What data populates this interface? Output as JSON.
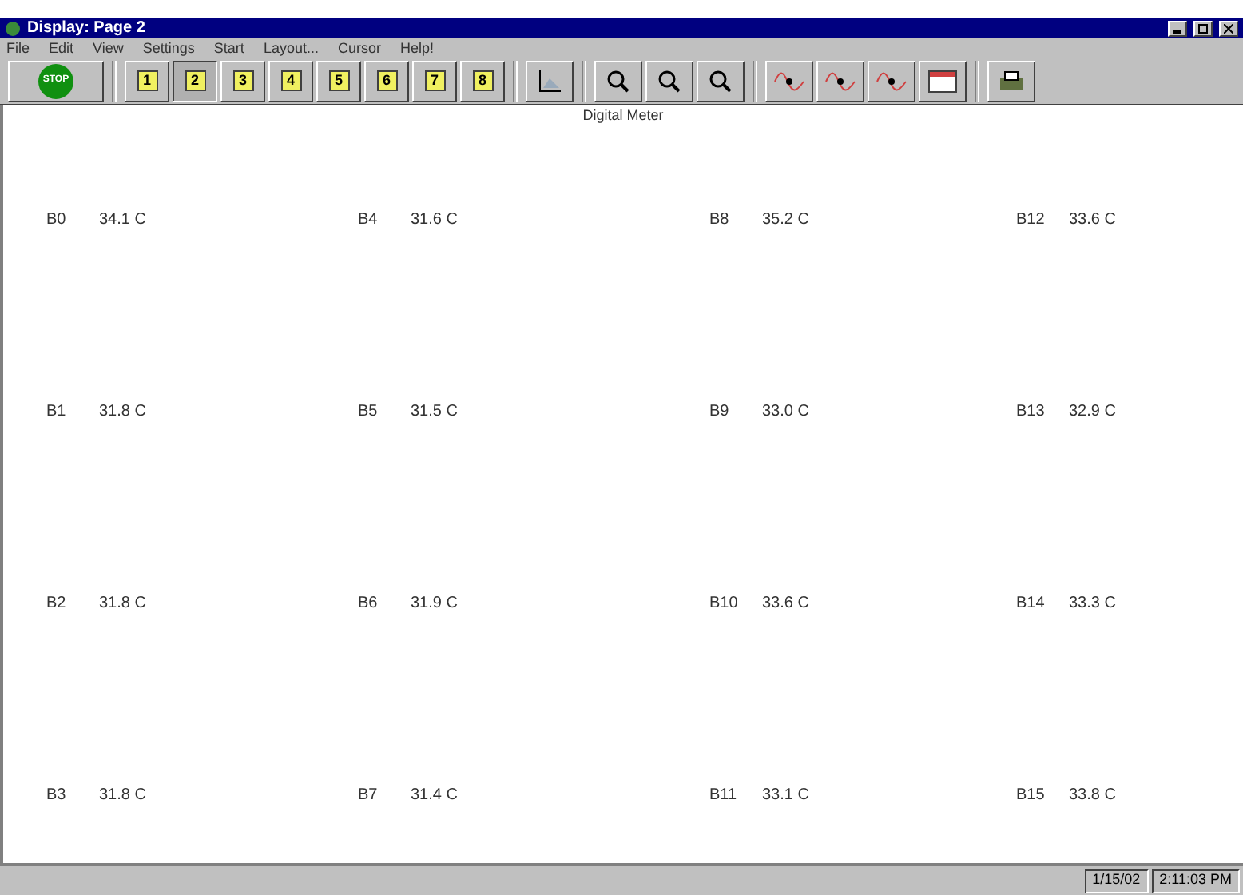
{
  "window": {
    "title": "Display: Page 2"
  },
  "menu": [
    "File",
    "Edit",
    "View",
    "Settings",
    "Start",
    "Layout...",
    "Cursor",
    "Help!"
  ],
  "toolbar": {
    "stop_label": "STOP",
    "pages": [
      {
        "label": "1",
        "selected": false
      },
      {
        "label": "2",
        "selected": true
      },
      {
        "label": "3",
        "selected": false
      },
      {
        "label": "4",
        "selected": false
      },
      {
        "label": "5",
        "selected": false
      },
      {
        "label": "6",
        "selected": false
      },
      {
        "label": "7",
        "selected": false
      },
      {
        "label": "8",
        "selected": false
      }
    ]
  },
  "heading": "Digital Meter",
  "meter_columns": [
    [
      {
        "name": "B0",
        "reading": "34.1 C"
      },
      {
        "name": "B1",
        "reading": "31.8 C"
      },
      {
        "name": "B2",
        "reading": "31.8 C"
      },
      {
        "name": "B3",
        "reading": "31.8 C"
      }
    ],
    [
      {
        "name": "B4",
        "reading": "31.6 C"
      },
      {
        "name": "B5",
        "reading": "31.5 C"
      },
      {
        "name": "B6",
        "reading": "31.9 C"
      },
      {
        "name": "B7",
        "reading": "31.4 C"
      }
    ],
    [
      {
        "name": "B8",
        "reading": "35.2 C"
      },
      {
        "name": "B9",
        "reading": "33.0 C"
      },
      {
        "name": "B10",
        "reading": "33.6 C"
      },
      {
        "name": "B11",
        "reading": "33.1 C"
      }
    ],
    [
      {
        "name": "B12",
        "reading": "33.6 C"
      },
      {
        "name": "B13",
        "reading": "32.9 C"
      },
      {
        "name": "B14",
        "reading": "33.3 C"
      },
      {
        "name": "B15",
        "reading": "33.8 C"
      }
    ]
  ],
  "status_bar": {
    "date": "1/15/02",
    "time": "2:11:03 PM"
  }
}
